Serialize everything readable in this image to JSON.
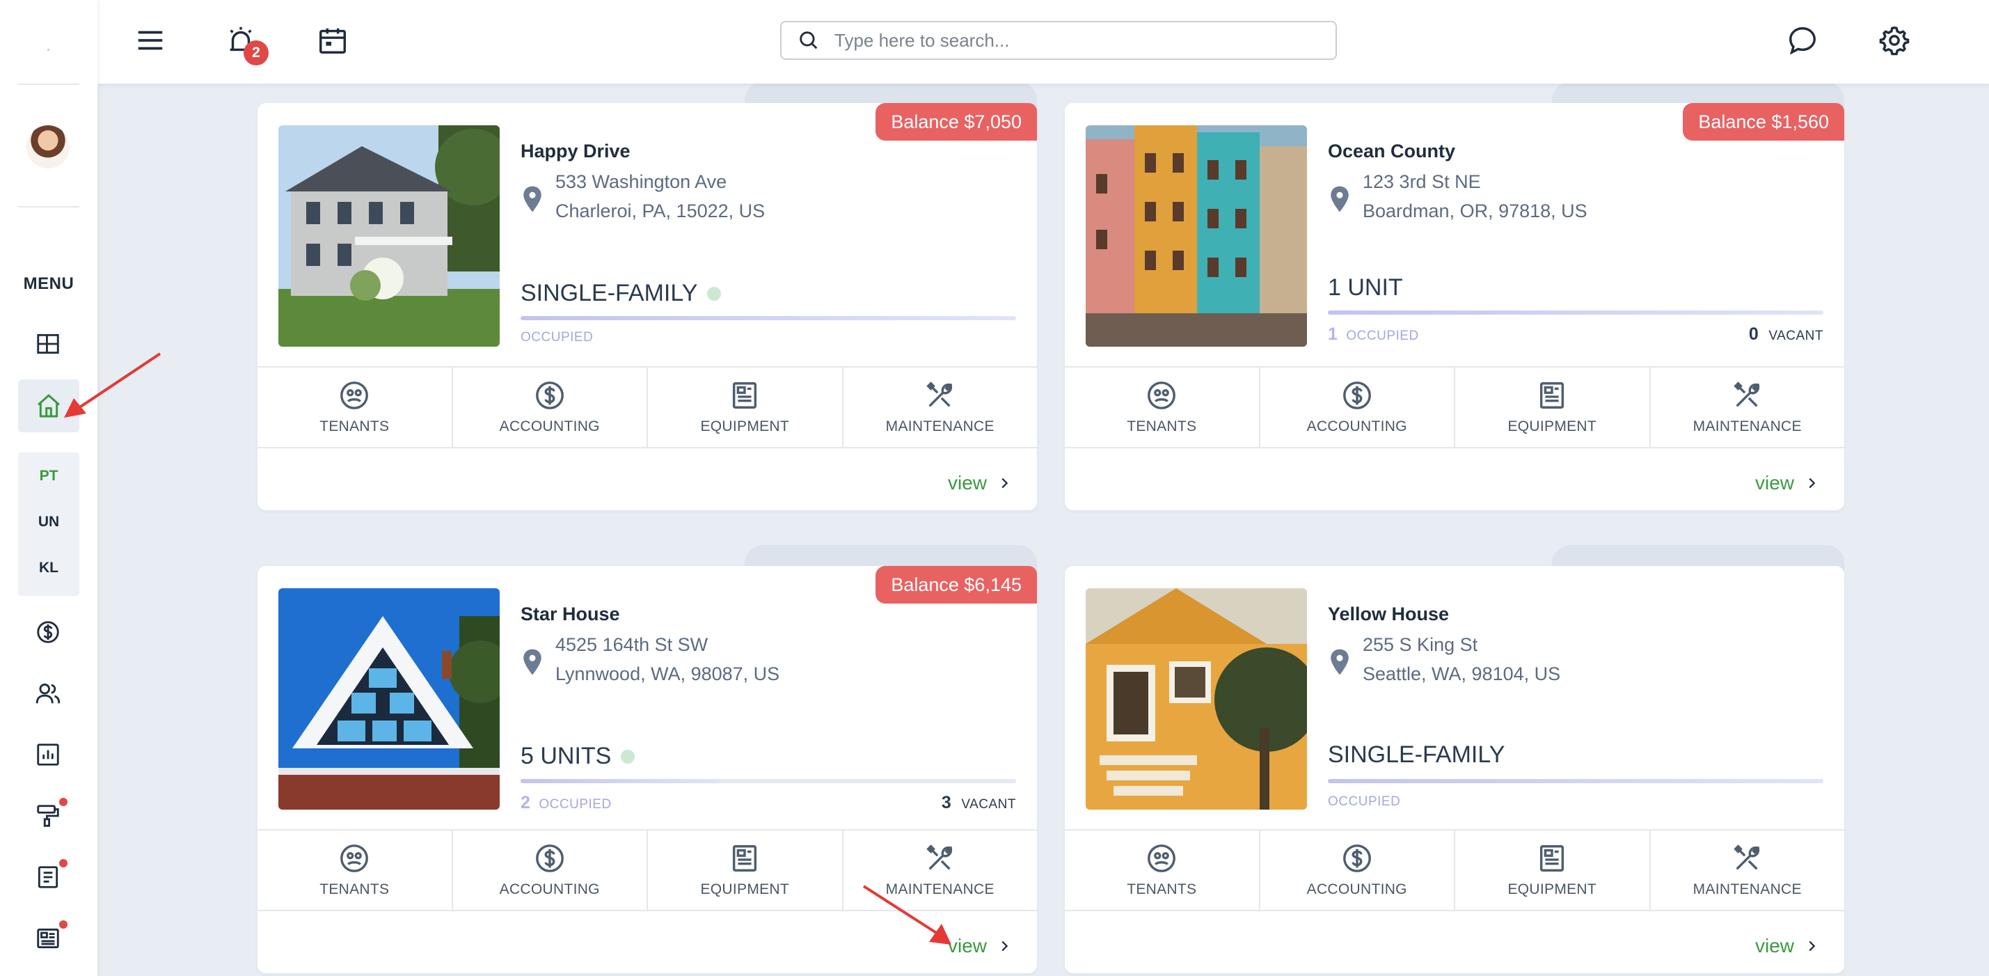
{
  "sidebar": {
    "menu_label": "MENU",
    "sub_items": [
      "PT",
      "UN",
      "KL"
    ],
    "colors": {
      "active": "#3a9a3e",
      "icon": "#1f2d3d",
      "alert_dot": "#e04848"
    }
  },
  "topbar": {
    "notification_count": "2",
    "search_placeholder": "Type here to search..."
  },
  "properties": [
    {
      "name": "Happy Drive",
      "address_line1": "533 Washington Ave",
      "address_line2": "Charleroi, PA, 15022, US",
      "balance": "Balance $7,050",
      "type": "SINGLE-FAMILY",
      "occupied_label": "OCCUPIED",
      "occupancy_fraction": 1.0,
      "image": "house-photo"
    },
    {
      "name": "Ocean County",
      "address_line1": "123 3rd St NE",
      "address_line2": "Boardman, OR, 97818, US",
      "balance": "Balance $1,560",
      "type": "1 UNIT",
      "occupied_count": "1",
      "occupied_label": "OCCUPIED",
      "vacant_count": "0",
      "vacant_label": "VACANT",
      "occupancy_fraction": 1.0,
      "image": "apartments-photo"
    },
    {
      "name": "Star House",
      "address_line1": "4525 164th St SW",
      "address_line2": "Lynnwood, WA, 98087, US",
      "balance": "Balance $6,145",
      "type": "5 UNITS",
      "occupied_count": "2",
      "occupied_label": "OCCUPIED",
      "vacant_count": "3",
      "vacant_label": "VACANT",
      "occupancy_fraction": 0.4,
      "image": "house-photo"
    },
    {
      "name": "Yellow House",
      "address_line1": "255 S King St",
      "address_line2": "Seattle, WA, 98104, US",
      "type": "SINGLE-FAMILY",
      "occupied_label": "OCCUPIED",
      "occupancy_fraction": 1.0,
      "image": "house-photo"
    }
  ],
  "actions": {
    "tenants": "TENANTS",
    "accounting": "ACCOUNTING",
    "equipment": "EQUIPMENT",
    "maintenance": "MAINTENANCE"
  },
  "view_label": "view",
  "colors": {
    "balance_badge": "#e86262",
    "view_link": "#3a9a3e",
    "occupancy_bar": "#c4c2ef",
    "annotation_arrow": "#e53935"
  }
}
